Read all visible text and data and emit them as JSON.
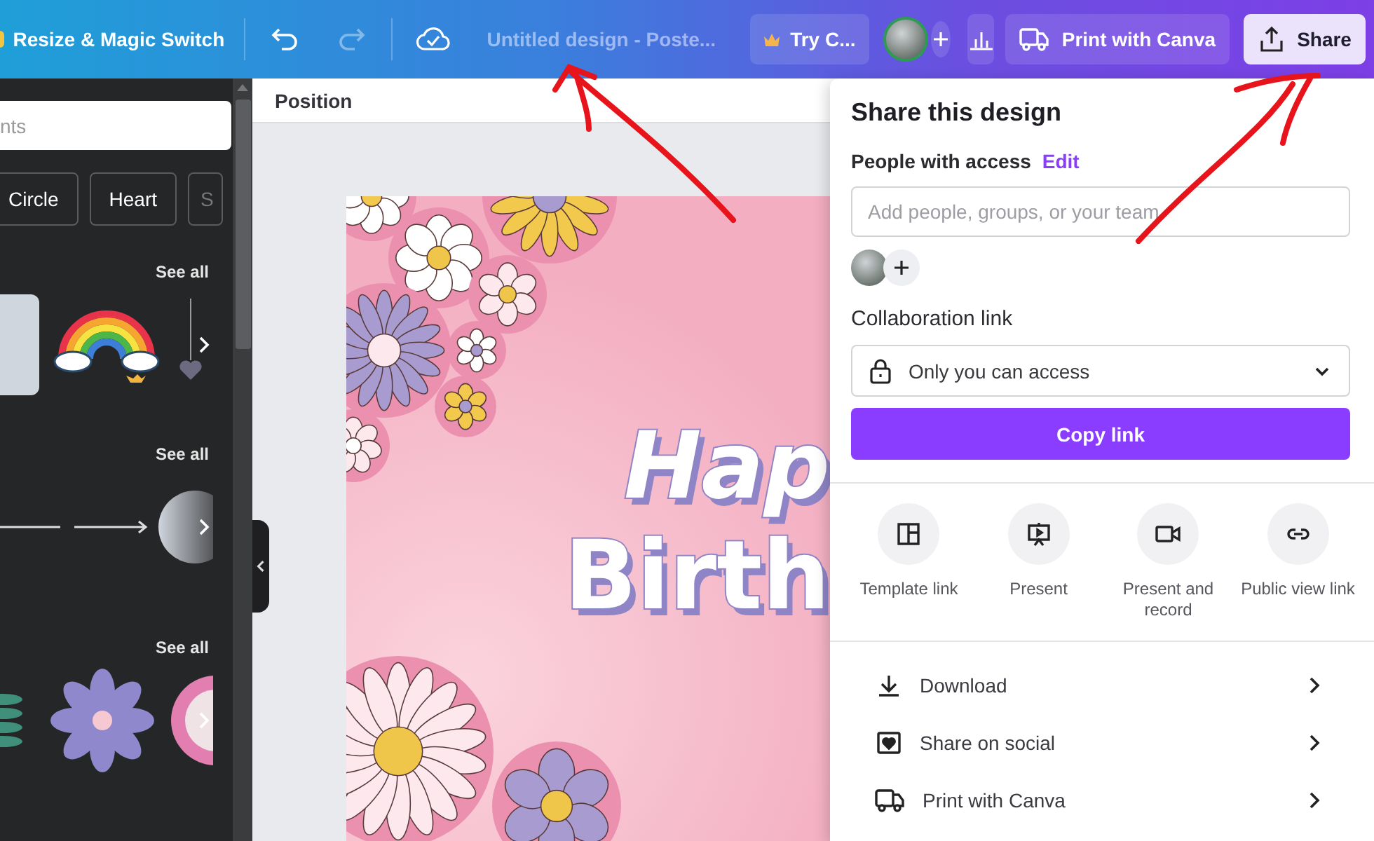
{
  "topbar": {
    "resize_label": "Resize & Magic Switch",
    "title": "Untitled design - Poste...",
    "try_label": "Try C...",
    "print_label": "Print with Canva",
    "share_label": "Share"
  },
  "left_panel": {
    "search_placeholder": "nts",
    "chips": [
      "Circle",
      "Heart",
      "S"
    ],
    "sections": [
      {
        "kind": "graphics",
        "see_all": "See all"
      },
      {
        "kind": "lines",
        "see_all": "See all"
      },
      {
        "kind": "flowers",
        "see_all": "See all"
      }
    ]
  },
  "editor": {
    "toolbar_label": "Position",
    "design": {
      "line_1": "Hap",
      "line_2": "Birth"
    }
  },
  "share_panel": {
    "title": "Share this design",
    "people_label": "People with access",
    "edit_link": "Edit",
    "people_placeholder": "Add people, groups, or your team",
    "collab_label": "Collaboration link",
    "access_value": "Only you can access",
    "copy_button": "Copy link",
    "actions": [
      {
        "kind": "template",
        "label": "Template link"
      },
      {
        "kind": "present",
        "label": "Present"
      },
      {
        "kind": "record",
        "label": "Present and record"
      },
      {
        "kind": "public",
        "label": "Public view link"
      }
    ],
    "menu": [
      {
        "kind": "download",
        "label": "Download"
      },
      {
        "kind": "social",
        "label": "Share on social"
      },
      {
        "kind": "print",
        "label": "Print with Canva"
      }
    ]
  }
}
